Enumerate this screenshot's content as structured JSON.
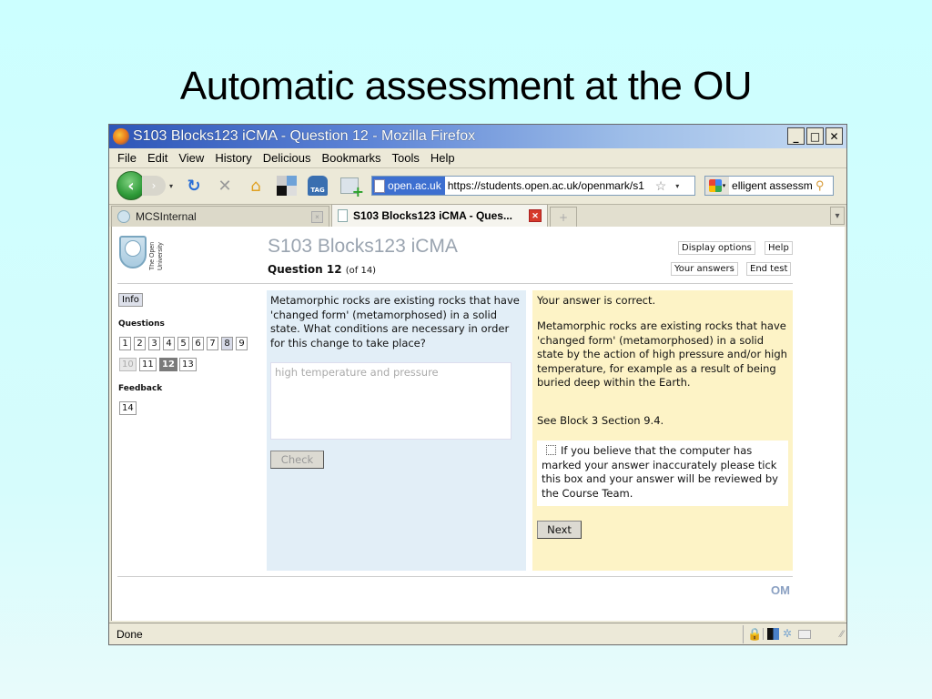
{
  "slide": {
    "title": "Automatic assessment at the OU"
  },
  "window": {
    "title": "S103 Blocks123 iCMA - Question 12 - Mozilla Firefox",
    "controls": {
      "minimize": "_",
      "maximize": "□",
      "close": "✕"
    }
  },
  "menu": [
    "File",
    "Edit",
    "View",
    "History",
    "Delicious",
    "Bookmarks",
    "Tools",
    "Help"
  ],
  "navbar": {
    "back": "‹",
    "forward": "›",
    "dropdown": "▾",
    "reload": "↻",
    "stop": "✕",
    "home": "⌂",
    "tag_label": "TAG",
    "site_identity": "open.ac.uk",
    "url": "https://students.open.ac.uk/openmark/s1",
    "bookmark_star": "☆",
    "url_dropdown": "▾",
    "search_text": "elligent assessm",
    "search_dropdown": "▾",
    "search_go": "⚲"
  },
  "tabs": [
    {
      "label": "MCSInternal",
      "close": "×",
      "active": false
    },
    {
      "label": "S103 Blocks123 iCMA - Ques...",
      "close": "✕",
      "active": true
    }
  ],
  "tabbar": {
    "new_tab": "+",
    "list": "▾"
  },
  "page": {
    "logo_text": "The Open University",
    "course_title": "S103 Blocks123 iCMA",
    "question_label": "Question 12",
    "question_of": "(of 14)",
    "header_buttons": {
      "display_options": "Display options",
      "help": "Help",
      "your_answers": "Your answers",
      "end_test": "End test"
    },
    "sidebar": {
      "info": "Info",
      "questions_heading": "Questions",
      "questions": [
        {
          "num": "1",
          "state": "normal"
        },
        {
          "num": "2",
          "state": "normal"
        },
        {
          "num": "3",
          "state": "normal"
        },
        {
          "num": "4",
          "state": "normal"
        },
        {
          "num": "5",
          "state": "normal"
        },
        {
          "num": "6",
          "state": "normal"
        },
        {
          "num": "7",
          "state": "normal"
        },
        {
          "num": "8",
          "state": "visited"
        },
        {
          "num": "9",
          "state": "normal"
        },
        {
          "num": "10",
          "state": "disabled"
        },
        {
          "num": "11",
          "state": "normal"
        },
        {
          "num": "12",
          "state": "current"
        },
        {
          "num": "13",
          "state": "normal"
        }
      ],
      "feedback_heading": "Feedback",
      "feedback": [
        {
          "num": "14",
          "state": "normal"
        }
      ]
    },
    "question": {
      "text": "Metamorphic rocks are existing rocks that have 'changed form' (metamorphosed) in a solid state. What conditions are necessary in order for this change to take place?",
      "answer": "high temperature and pressure",
      "check_label": "Check"
    },
    "feedback": {
      "result": "Your answer is correct.",
      "explanation": "Metamorphic rocks are existing rocks that have 'changed form' (metamorphosed) in a solid state by the action of high pressure and/or high temperature, for example as a result of being buried deep within the Earth.",
      "reference": "See Block 3 Section 9.4.",
      "appeal": "If you believe that the computer has marked your answer inaccurately please tick this box and your answer will be reviewed by the Course Team.",
      "next_label": "Next"
    },
    "footer_logo": "OM"
  },
  "status": {
    "text": "Done",
    "lock": "🔒",
    "grip": "⁄⁄"
  },
  "colors": {
    "slide_bg": "#ccffff",
    "question_panel": "#e2eef7",
    "feedback_panel": "#fdf3c6",
    "current_question": "#7a7a7a"
  }
}
